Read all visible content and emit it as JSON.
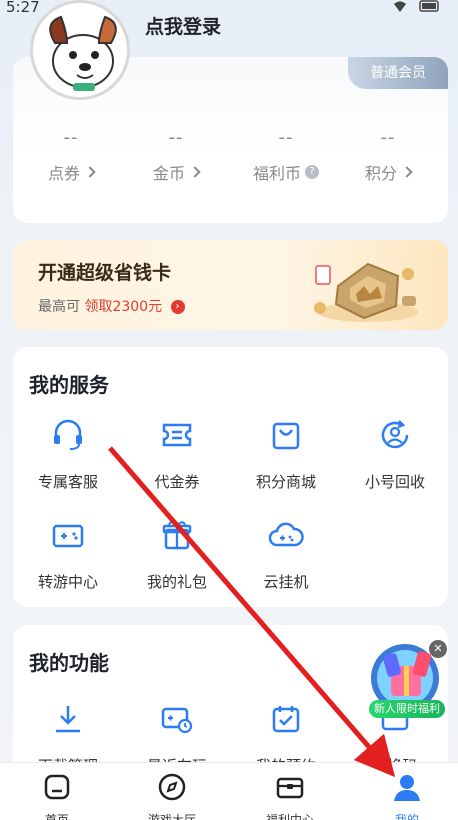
{
  "status_bar": {
    "time": "5:27"
  },
  "user": {
    "name": "点我登录"
  },
  "member": {
    "level": "普通会员"
  },
  "assets": [
    {
      "value": "--",
      "label": "点券"
    },
    {
      "value": "--",
      "label": "金币"
    },
    {
      "value": "--",
      "label": "福利币"
    },
    {
      "value": "--",
      "label": "积分"
    }
  ],
  "saving_card": {
    "title": "开通超级省钱卡",
    "prefix": "最高可",
    "highlight": "领取2300元"
  },
  "services": {
    "title": "我的服务",
    "items": [
      {
        "label": "专属客服",
        "icon": "headset-icon"
      },
      {
        "label": "代金券",
        "icon": "voucher-icon"
      },
      {
        "label": "积分商城",
        "icon": "shopping-bag-icon"
      },
      {
        "label": "小号回收",
        "icon": "recycle-user-icon"
      },
      {
        "label": "转游中心",
        "icon": "gamepad-icon"
      },
      {
        "label": "我的礼包",
        "icon": "gift-icon"
      },
      {
        "label": "云挂机",
        "icon": "cloud-gamepad-icon"
      }
    ]
  },
  "functions": {
    "title": "我的功能",
    "items": [
      {
        "label": "下载管理",
        "icon": "download-icon"
      },
      {
        "label": "最近在玩",
        "icon": "recent-play-icon"
      },
      {
        "label": "我的预约",
        "icon": "calendar-icon"
      },
      {
        "label": "兑换码",
        "icon": "redeem-code-icon"
      }
    ]
  },
  "float_promo": {
    "label": "新人限时福利"
  },
  "tabs": [
    {
      "label": "首页",
      "icon": "home-icon",
      "active": false
    },
    {
      "label": "游戏大厅",
      "icon": "compass-icon",
      "active": false
    },
    {
      "label": "福利中心",
      "icon": "gift-box-icon",
      "active": false
    },
    {
      "label": "我的",
      "icon": "user-icon",
      "active": true
    }
  ],
  "colors": {
    "accent": "#2c7cf6",
    "highlight_red": "#e23b2f",
    "annotation_arrow": "#e32020"
  }
}
